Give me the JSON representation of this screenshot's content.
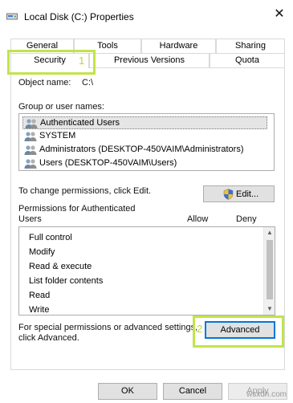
{
  "window": {
    "title": "Local Disk (C:) Properties"
  },
  "tabs": {
    "row1": [
      "General",
      "Tools",
      "Hardware",
      "Sharing"
    ],
    "row2": [
      "Security",
      "Previous Versions",
      "Quota"
    ]
  },
  "annotations": {
    "step1": "1",
    "step2": "2"
  },
  "object_name": {
    "label": "Object name:",
    "value": "C:\\"
  },
  "groups": {
    "label": "Group or user names:",
    "items": [
      "Authenticated Users",
      "SYSTEM",
      "Administrators (DESKTOP-450VAIM\\Administrators)",
      "Users (DESKTOP-450VAIM\\Users)"
    ]
  },
  "change_text": "To change permissions, click Edit.",
  "edit_button": "Edit...",
  "permissions": {
    "label_line1": "Permissions for Authenticated",
    "label_line2": "Users",
    "allow_header": "Allow",
    "deny_header": "Deny",
    "rows": [
      "Full control",
      "Modify",
      "Read & execute",
      "List folder contents",
      "Read",
      "Write"
    ]
  },
  "special": {
    "line1": "For special permissions or advanced settings,",
    "line2": "click Advanced."
  },
  "advanced_button": "Advanced",
  "buttons": {
    "ok": "OK",
    "cancel": "Cancel",
    "apply": "Apply"
  },
  "watermark": "wsxdn.com",
  "colors": {
    "highlight": "#c2e34b",
    "selection": "#e5e5e5",
    "button_focus": "#0078d7"
  }
}
